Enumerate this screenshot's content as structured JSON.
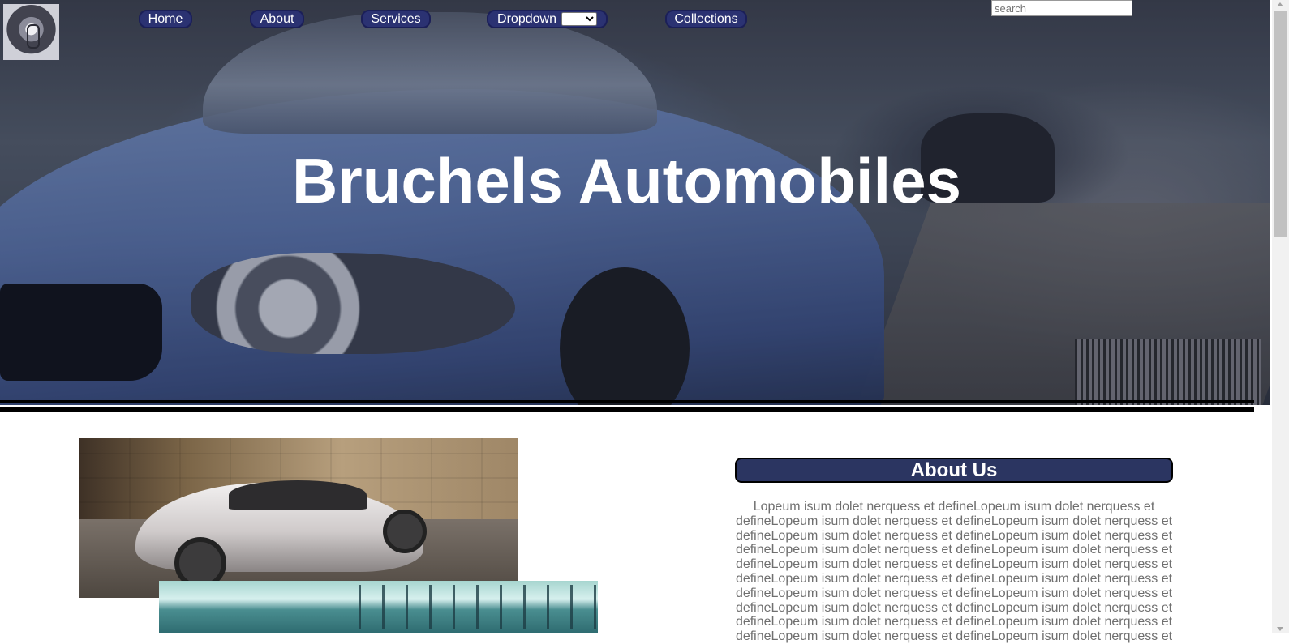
{
  "nav": {
    "items": [
      {
        "label": "Home"
      },
      {
        "label": "About"
      },
      {
        "label": "Services"
      },
      {
        "label": "Dropdown"
      },
      {
        "label": "Collections"
      }
    ],
    "dropdown_selected": ""
  },
  "search": {
    "placeholder": "search",
    "value": ""
  },
  "hero": {
    "title": "Bruchels Automobiles"
  },
  "about": {
    "heading": "About Us",
    "body": "Lopeum isum dolet nerquess et defineLopeum isum dolet nerquess et defineLopeum isum dolet nerquess et defineLopeum isum dolet nerquess et defineLopeum isum dolet nerquess et defineLopeum isum dolet nerquess et defineLopeum isum dolet nerquess et defineLopeum isum dolet nerquess et defineLopeum isum dolet nerquess et defineLopeum isum dolet nerquess et defineLopeum isum dolet nerquess et defineLopeum isum dolet nerquess et defineLopeum isum dolet nerquess et defineLopeum isum dolet nerquess et defineLopeum isum dolet nerquess et defineLopeum isum dolet nerquess et defineLopeum isum dolet nerquess et defineLopeum isum dolet nerquess et defineLopeum isum dolet nerquess et defineLopeum isum dolet nerquess et"
  },
  "colors": {
    "nav_button": "#2b3272",
    "about_heading_bg": "#2b3561",
    "body_text": "#6f6f6f"
  },
  "icons": {
    "logo": "car-emblem-logo"
  }
}
